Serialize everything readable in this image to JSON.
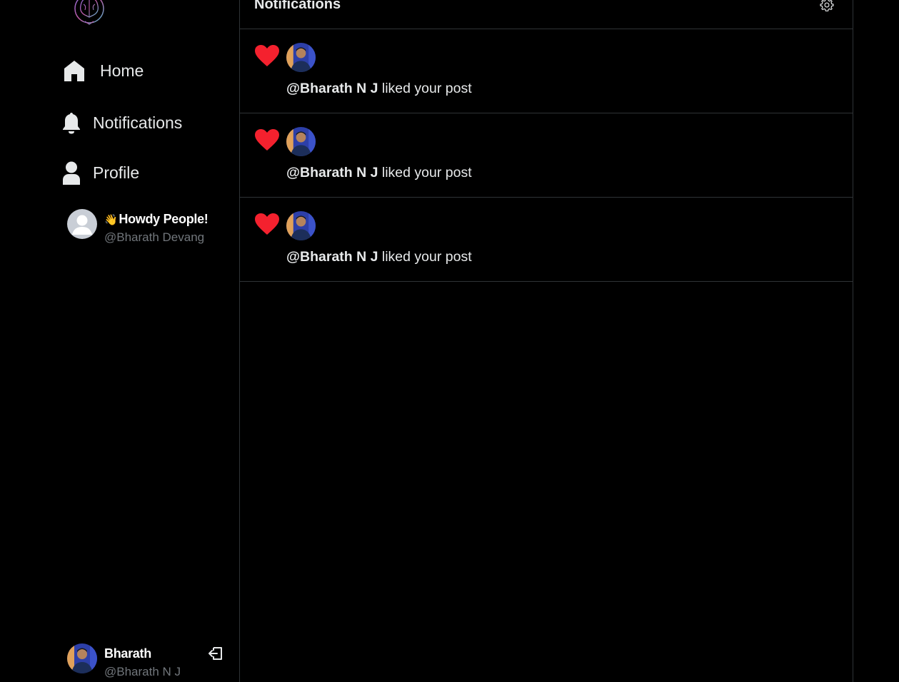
{
  "nav": {
    "home_label": "Home",
    "notifications_label": "Notifications",
    "profile_label": "Profile"
  },
  "suggestion": {
    "bio": "Howdy People!",
    "bio_emoji": "👋",
    "handle": "@Bharath Devang"
  },
  "current_user": {
    "name": "Bharath",
    "handle": "@Bharath N J"
  },
  "header": {
    "title": "Notifications"
  },
  "notifications": [
    {
      "user": "@Bharath N J",
      "action": " liked your post"
    },
    {
      "user": "@Bharath N J",
      "action": " liked your post"
    },
    {
      "user": "@Bharath N J",
      "action": " liked your post"
    }
  ],
  "colors": {
    "background": "#000000",
    "border": "#2f3336",
    "text": "#e7e9ea",
    "muted": "#71767b",
    "heart": "#f4212e"
  },
  "icons": [
    "logo-icon",
    "home-icon",
    "bell-icon",
    "user-icon",
    "logout-icon",
    "gear-icon",
    "heart-icon"
  ]
}
